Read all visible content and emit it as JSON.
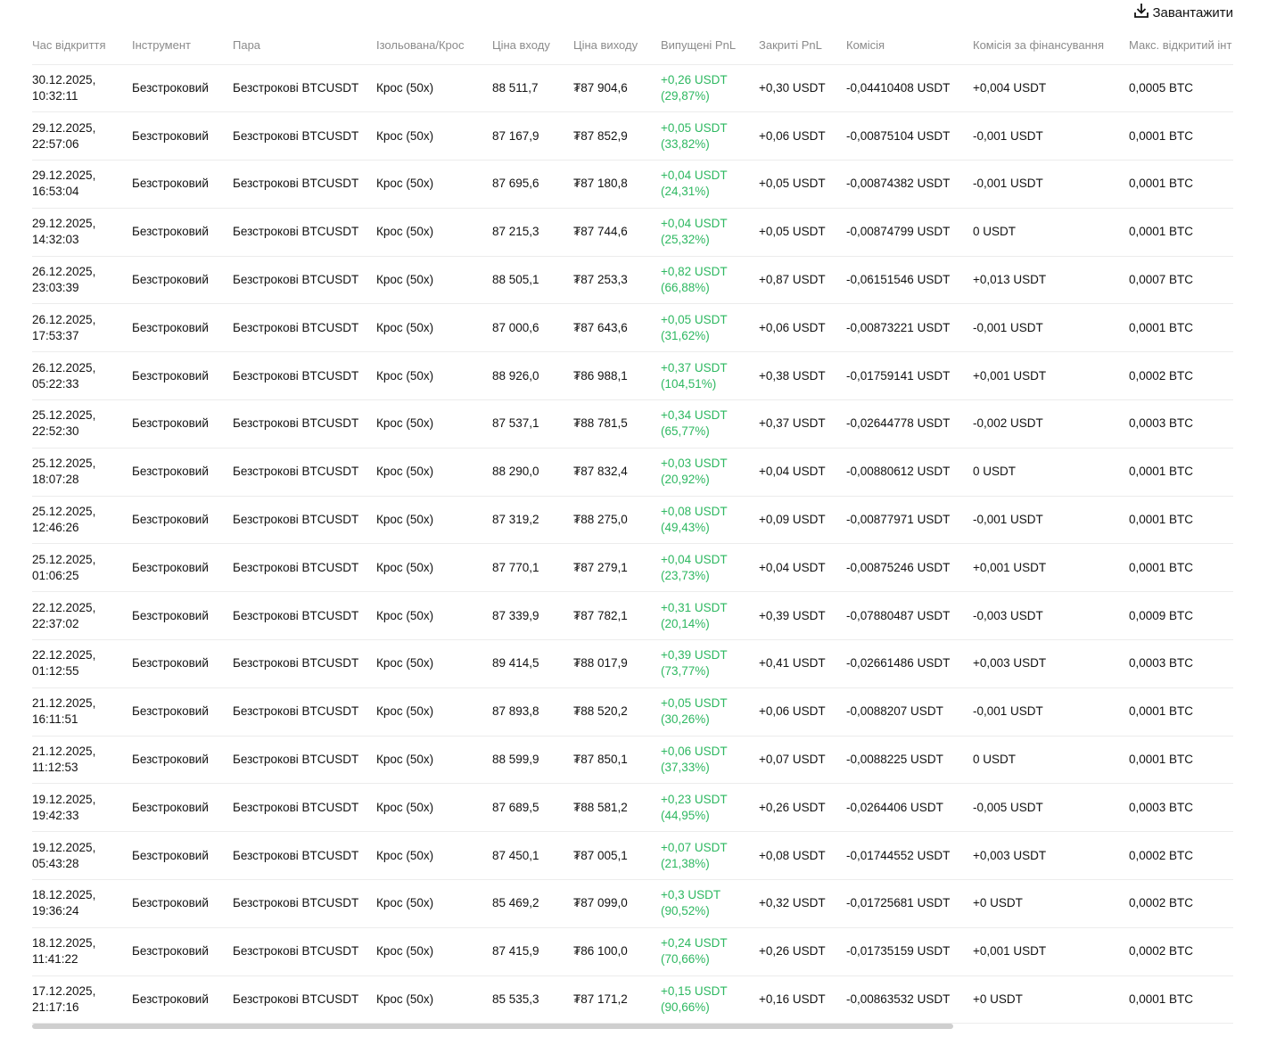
{
  "download_label": "Завантажити",
  "headers": [
    "Час відкриття",
    "Інструмент",
    "Пара",
    "Ізольована/Крос",
    "Ціна входу",
    "Ціна виходу",
    "Випущені PnL",
    "Закриті PnL",
    "Комісія",
    "Комісія за фінансування",
    "Макс. відкритий інт"
  ],
  "rows": [
    {
      "time_date": "30.12.2025,",
      "time_clock": "10:32:11",
      "instrument": "Безстроковий",
      "pair": "Безстрокові BTCUSDT",
      "mode": "Крос (50x)",
      "entry": "88 511,7",
      "exit": "₮87 904,6",
      "pnl_value": "+0,26 USDT",
      "pnl_pct": "(29,87%)",
      "closed_pnl": "+0,30 USDT",
      "fee": "-0,04410408 USDT",
      "funding": "+0,004 USDT",
      "max_oi": "0,0005 BTC"
    },
    {
      "time_date": "29.12.2025,",
      "time_clock": "22:57:06",
      "instrument": "Безстроковий",
      "pair": "Безстрокові BTCUSDT",
      "mode": "Крос (50x)",
      "entry": "87 167,9",
      "exit": "₮87 852,9",
      "pnl_value": "+0,05 USDT",
      "pnl_pct": "(33,82%)",
      "closed_pnl": "+0,06 USDT",
      "fee": "-0,00875104 USDT",
      "funding": "-0,001 USDT",
      "max_oi": "0,0001 BTC"
    },
    {
      "time_date": "29.12.2025,",
      "time_clock": "16:53:04",
      "instrument": "Безстроковий",
      "pair": "Безстрокові BTCUSDT",
      "mode": "Крос (50x)",
      "entry": "87 695,6",
      "exit": "₮87 180,8",
      "pnl_value": "+0,04 USDT",
      "pnl_pct": "(24,31%)",
      "closed_pnl": "+0,05 USDT",
      "fee": "-0,00874382 USDT",
      "funding": "-0,001 USDT",
      "max_oi": "0,0001 BTC"
    },
    {
      "time_date": "29.12.2025,",
      "time_clock": "14:32:03",
      "instrument": "Безстроковий",
      "pair": "Безстрокові BTCUSDT",
      "mode": "Крос (50x)",
      "entry": "87 215,3",
      "exit": "₮87 744,6",
      "pnl_value": "+0,04 USDT",
      "pnl_pct": "(25,32%)",
      "closed_pnl": "+0,05 USDT",
      "fee": "-0,00874799 USDT",
      "funding": "0 USDT",
      "max_oi": "0,0001 BTC"
    },
    {
      "time_date": "26.12.2025,",
      "time_clock": "23:03:39",
      "instrument": "Безстроковий",
      "pair": "Безстрокові BTCUSDT",
      "mode": "Крос (50x)",
      "entry": "88 505,1",
      "exit": "₮87 253,3",
      "pnl_value": "+0,82 USDT",
      "pnl_pct": "(66,88%)",
      "closed_pnl": "+0,87 USDT",
      "fee": "-0,06151546 USDT",
      "funding": "+0,013 USDT",
      "max_oi": "0,0007 BTC"
    },
    {
      "time_date": "26.12.2025,",
      "time_clock": "17:53:37",
      "instrument": "Безстроковий",
      "pair": "Безстрокові BTCUSDT",
      "mode": "Крос (50x)",
      "entry": "87 000,6",
      "exit": "₮87 643,6",
      "pnl_value": "+0,05 USDT",
      "pnl_pct": "(31,62%)",
      "closed_pnl": "+0,06 USDT",
      "fee": "-0,00873221 USDT",
      "funding": "-0,001 USDT",
      "max_oi": "0,0001 BTC"
    },
    {
      "time_date": "26.12.2025,",
      "time_clock": "05:22:33",
      "instrument": "Безстроковий",
      "pair": "Безстрокові BTCUSDT",
      "mode": "Крос (50x)",
      "entry": "88 926,0",
      "exit": "₮86 988,1",
      "pnl_value": "+0,37 USDT",
      "pnl_pct": "(104,51%)",
      "closed_pnl": "+0,38 USDT",
      "fee": "-0,01759141 USDT",
      "funding": "+0,001 USDT",
      "max_oi": "0,0002 BTC"
    },
    {
      "time_date": "25.12.2025,",
      "time_clock": "22:52:30",
      "instrument": "Безстроковий",
      "pair": "Безстрокові BTCUSDT",
      "mode": "Крос (50x)",
      "entry": "87 537,1",
      "exit": "₮88 781,5",
      "pnl_value": "+0,34 USDT",
      "pnl_pct": "(65,77%)",
      "closed_pnl": "+0,37 USDT",
      "fee": "-0,02644778 USDT",
      "funding": "-0,002 USDT",
      "max_oi": "0,0003 BTC"
    },
    {
      "time_date": "25.12.2025,",
      "time_clock": "18:07:28",
      "instrument": "Безстроковий",
      "pair": "Безстрокові BTCUSDT",
      "mode": "Крос (50x)",
      "entry": "88 290,0",
      "exit": "₮87 832,4",
      "pnl_value": "+0,03 USDT",
      "pnl_pct": "(20,92%)",
      "closed_pnl": "+0,04 USDT",
      "fee": "-0,00880612 USDT",
      "funding": "0 USDT",
      "max_oi": "0,0001 BTC"
    },
    {
      "time_date": "25.12.2025,",
      "time_clock": "12:46:26",
      "instrument": "Безстроковий",
      "pair": "Безстрокові BTCUSDT",
      "mode": "Крос (50x)",
      "entry": "87 319,2",
      "exit": "₮88 275,0",
      "pnl_value": "+0,08 USDT",
      "pnl_pct": "(49,43%)",
      "closed_pnl": "+0,09 USDT",
      "fee": "-0,00877971 USDT",
      "funding": "-0,001 USDT",
      "max_oi": "0,0001 BTC"
    },
    {
      "time_date": "25.12.2025,",
      "time_clock": "01:06:25",
      "instrument": "Безстроковий",
      "pair": "Безстрокові BTCUSDT",
      "mode": "Крос (50x)",
      "entry": "87 770,1",
      "exit": "₮87 279,1",
      "pnl_value": "+0,04 USDT",
      "pnl_pct": "(23,73%)",
      "closed_pnl": "+0,04 USDT",
      "fee": "-0,00875246 USDT",
      "funding": "+0,001 USDT",
      "max_oi": "0,0001 BTC"
    },
    {
      "time_date": "22.12.2025,",
      "time_clock": "22:37:02",
      "instrument": "Безстроковий",
      "pair": "Безстрокові BTCUSDT",
      "mode": "Крос (50x)",
      "entry": "87 339,9",
      "exit": "₮87 782,1",
      "pnl_value": "+0,31 USDT",
      "pnl_pct": "(20,14%)",
      "closed_pnl": "+0,39 USDT",
      "fee": "-0,07880487 USDT",
      "funding": "-0,003 USDT",
      "max_oi": "0,0009 BTC"
    },
    {
      "time_date": "22.12.2025,",
      "time_clock": "01:12:55",
      "instrument": "Безстроковий",
      "pair": "Безстрокові BTCUSDT",
      "mode": "Крос (50x)",
      "entry": "89 414,5",
      "exit": "₮88 017,9",
      "pnl_value": "+0,39 USDT",
      "pnl_pct": "(73,77%)",
      "closed_pnl": "+0,41 USDT",
      "fee": "-0,02661486 USDT",
      "funding": "+0,003 USDT",
      "max_oi": "0,0003 BTC"
    },
    {
      "time_date": "21.12.2025,",
      "time_clock": "16:11:51",
      "instrument": "Безстроковий",
      "pair": "Безстрокові BTCUSDT",
      "mode": "Крос (50x)",
      "entry": "87 893,8",
      "exit": "₮88 520,2",
      "pnl_value": "+0,05 USDT",
      "pnl_pct": "(30,26%)",
      "closed_pnl": "+0,06 USDT",
      "fee": "-0,0088207 USDT",
      "funding": "-0,001 USDT",
      "max_oi": "0,0001 BTC"
    },
    {
      "time_date": "21.12.2025,",
      "time_clock": "11:12:53",
      "instrument": "Безстроковий",
      "pair": "Безстрокові BTCUSDT",
      "mode": "Крос (50x)",
      "entry": "88 599,9",
      "exit": "₮87 850,1",
      "pnl_value": "+0,06 USDT",
      "pnl_pct": "(37,33%)",
      "closed_pnl": "+0,07 USDT",
      "fee": "-0,0088225 USDT",
      "funding": "0 USDT",
      "max_oi": "0,0001 BTC"
    },
    {
      "time_date": "19.12.2025,",
      "time_clock": "19:42:33",
      "instrument": "Безстроковий",
      "pair": "Безстрокові BTCUSDT",
      "mode": "Крос (50x)",
      "entry": "87 689,5",
      "exit": "₮88 581,2",
      "pnl_value": "+0,23 USDT",
      "pnl_pct": "(44,95%)",
      "closed_pnl": "+0,26 USDT",
      "fee": "-0,0264406 USDT",
      "funding": "-0,005 USDT",
      "max_oi": "0,0003 BTC"
    },
    {
      "time_date": "19.12.2025,",
      "time_clock": "05:43:28",
      "instrument": "Безстроковий",
      "pair": "Безстрокові BTCUSDT",
      "mode": "Крос (50x)",
      "entry": "87 450,1",
      "exit": "₮87 005,1",
      "pnl_value": "+0,07 USDT",
      "pnl_pct": "(21,38%)",
      "closed_pnl": "+0,08 USDT",
      "fee": "-0,01744552 USDT",
      "funding": "+0,003 USDT",
      "max_oi": "0,0002 BTC"
    },
    {
      "time_date": "18.12.2025,",
      "time_clock": "19:36:24",
      "instrument": "Безстроковий",
      "pair": "Безстрокові BTCUSDT",
      "mode": "Крос (50x)",
      "entry": "85 469,2",
      "exit": "₮87 099,0",
      "pnl_value": "+0,3 USDT",
      "pnl_pct": "(90,52%)",
      "closed_pnl": "+0,32 USDT",
      "fee": "-0,01725681 USDT",
      "funding": "+0 USDT",
      "max_oi": "0,0002 BTC"
    },
    {
      "time_date": "18.12.2025,",
      "time_clock": "11:41:22",
      "instrument": "Безстроковий",
      "pair": "Безстрокові BTCUSDT",
      "mode": "Крос (50x)",
      "entry": "87 415,9",
      "exit": "₮86 100,0",
      "pnl_value": "+0,24 USDT",
      "pnl_pct": "(70,66%)",
      "closed_pnl": "+0,26 USDT",
      "fee": "-0,01735159 USDT",
      "funding": "+0,001 USDT",
      "max_oi": "0,0002 BTC"
    },
    {
      "time_date": "17.12.2025,",
      "time_clock": "21:17:16",
      "instrument": "Безстроковий",
      "pair": "Безстрокові BTCUSDT",
      "mode": "Крос (50x)",
      "entry": "85 535,3",
      "exit": "₮87 171,2",
      "pnl_value": "+0,15 USDT",
      "pnl_pct": "(90,66%)",
      "closed_pnl": "+0,16 USDT",
      "fee": "-0,00863532 USDT",
      "funding": "+0 USDT",
      "max_oi": "0,0001 BTC"
    }
  ],
  "colors": {
    "pnl_positive": "#2eb861",
    "header_text": "#8b8b8b",
    "row_border": "#ececec",
    "scrollbar": "#cfcfcf"
  },
  "icons": {
    "download": "download-icon"
  }
}
